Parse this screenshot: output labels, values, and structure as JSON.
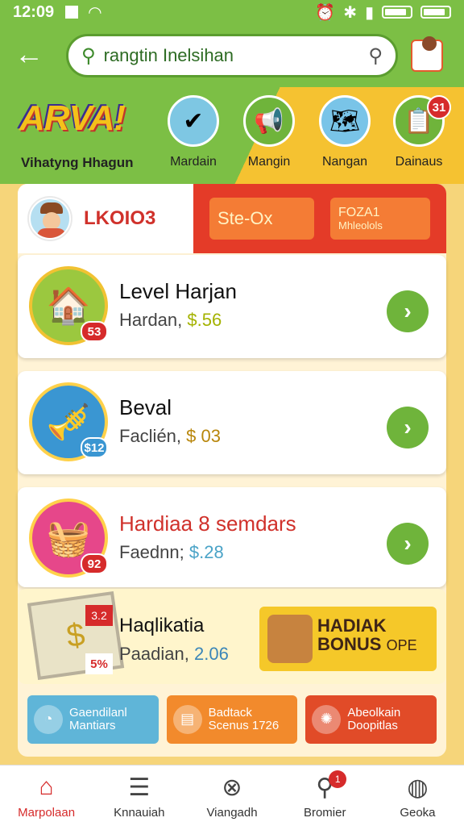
{
  "status": {
    "time": "12:09"
  },
  "header": {
    "search_value": "rangtin Inelsihan"
  },
  "banner": {
    "logo": "ARVA!",
    "tagline": "Vihatyng Hhagun",
    "categories": [
      {
        "label": "Mardain",
        "icon": "check-icon",
        "color": "#7ec7e3"
      },
      {
        "label": "Mangin",
        "icon": "megaphone-icon",
        "color": "#6fb43b"
      },
      {
        "label": "Nangan",
        "icon": "map-icon",
        "color": "#79c4e8"
      },
      {
        "label": "Dainaus",
        "icon": "board-icon",
        "color": "#6fb43b",
        "badge": "31"
      }
    ]
  },
  "tabs": {
    "left_label": "LKOIO3",
    "pill1": "Ste-Ox",
    "pill2_main": "FOZA1",
    "pill2_sub": "Mhleolols"
  },
  "items": [
    {
      "title": "Level Harjan",
      "sub": "Hardan,",
      "price": "$.56",
      "badge": "53"
    },
    {
      "title": "Beval",
      "sub": "Faclién,",
      "price": "$ 03",
      "badge": "$12"
    },
    {
      "title": "Hardiaa 8 semdars",
      "sub": "Faednn;",
      "price": "$.28",
      "badge": "92"
    }
  ],
  "bonus": {
    "title": "Haqlikatia",
    "sub": "Paadian,",
    "price": "2.06",
    "badge1": "3.2",
    "badge2": "5%",
    "card_line1": "HADIAK",
    "card_line2": "BONUS",
    "card_line3": "OPE"
  },
  "tiles": [
    {
      "line1": "Gaendilanl",
      "line2": "Mantiars"
    },
    {
      "line1": "Badtack",
      "line2": "Scenus 1726"
    },
    {
      "line1": "Abeolkain",
      "line2": "Doopitlas"
    }
  ],
  "nav": [
    {
      "label": "Marpolaan",
      "icon": "home-icon",
      "active": true
    },
    {
      "label": "Knnauiah",
      "icon": "list-icon",
      "active": false
    },
    {
      "label": "Viangadh",
      "icon": "close-circle-icon",
      "active": false
    },
    {
      "label": "Bromier",
      "icon": "search-icon",
      "active": false,
      "badge": "1"
    },
    {
      "label": "Geoka",
      "icon": "globe-icon",
      "active": false
    }
  ]
}
